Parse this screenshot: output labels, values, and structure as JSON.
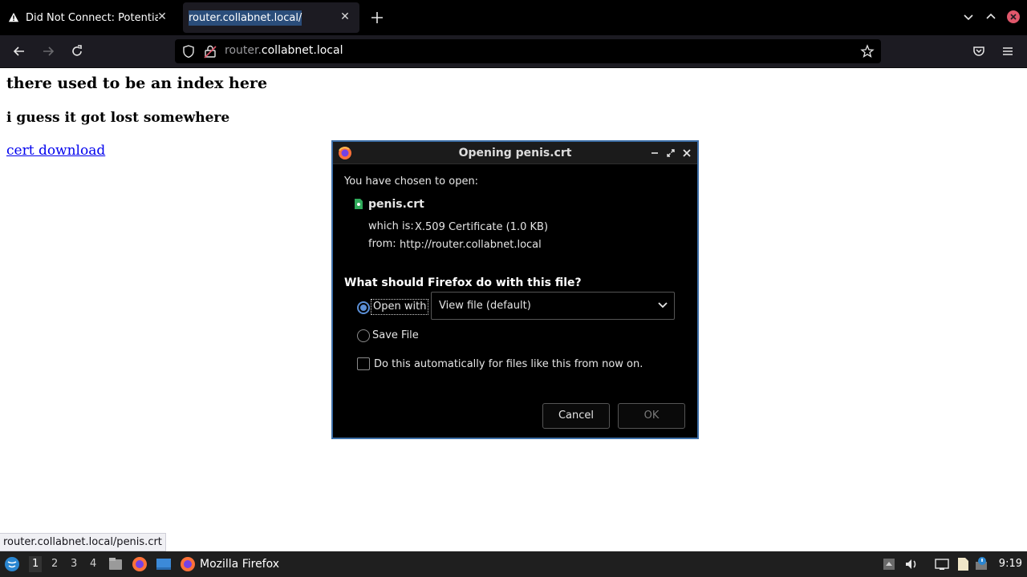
{
  "tabs": [
    {
      "title": "Did Not Connect: Potential Security Issue",
      "icon": "warning-icon"
    },
    {
      "title": "router.collabnet.local/",
      "active": true
    }
  ],
  "urlbar": {
    "host_dim": "router.",
    "host_main": "collabnet.local"
  },
  "page": {
    "heading": "there used to be an index here",
    "subheading": "i guess it got lost somewhere",
    "link": "cert download"
  },
  "status_url": "router.collabnet.local/penis.crt",
  "dialog": {
    "title": "Opening penis.crt",
    "intro": "You have chosen to open:",
    "filename": "penis.crt",
    "which_is_label": "which is:",
    "which_is_value": "X.509 Certificate (1.0 KB)",
    "from_label": "from:",
    "from_value": "http://router.collabnet.local",
    "question": "What should Firefox do with this file?",
    "open_with": "Open with",
    "open_with_value": "View file (default)",
    "save_file": "Save File",
    "auto_label": "Do this automatically for files like this from now on.",
    "cancel": "Cancel",
    "ok": "OK"
  },
  "taskbar": {
    "workspaces": [
      "1",
      "2",
      "3",
      "4"
    ],
    "app_label": "Mozilla Firefox",
    "clock": "9:19"
  },
  "colors": {
    "accent": "#3d6fa8",
    "link": "#0000ee",
    "radio": "#5b8fd6"
  }
}
